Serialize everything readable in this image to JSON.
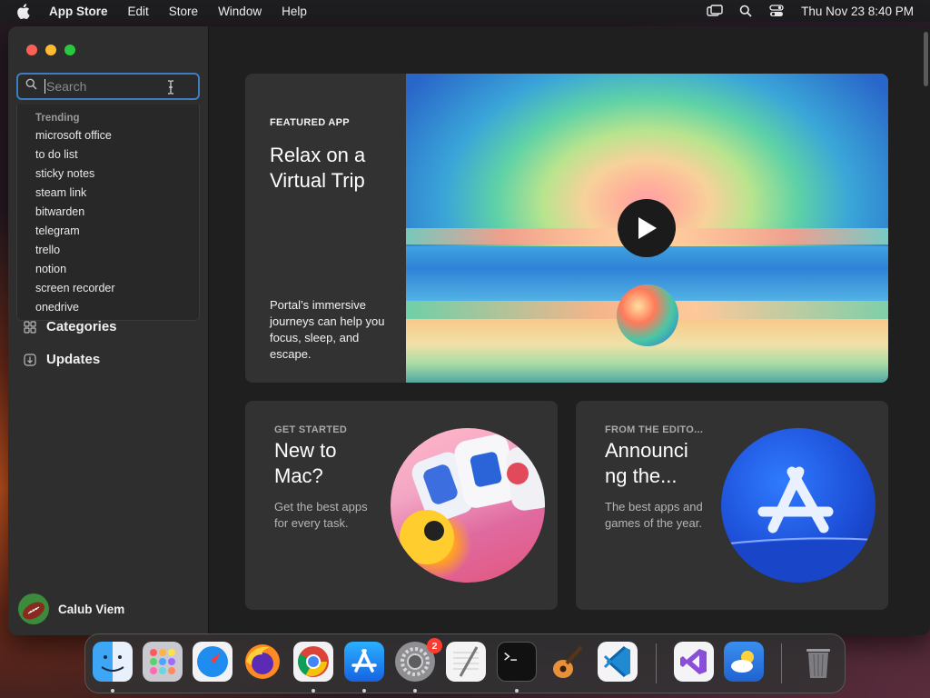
{
  "menubar": {
    "app_name": "App Store",
    "menus": [
      "Edit",
      "Store",
      "Window",
      "Help"
    ],
    "clock": "Thu Nov 23  8:40 PM"
  },
  "sidebar": {
    "search": {
      "placeholder": "Search",
      "value": ""
    },
    "trending_header": "Trending",
    "suggestions": [
      "microsoft office",
      "to do list",
      "sticky notes",
      "steam link",
      "bitwarden",
      "telegram",
      "trello",
      "notion",
      "screen recorder",
      "onedrive"
    ],
    "nav": [
      {
        "label": "Categories",
        "icon": "grid-icon"
      },
      {
        "label": "Updates",
        "icon": "download-icon"
      }
    ],
    "user_name": "Calub Viem"
  },
  "featured": {
    "eyebrow": "FEATURED APP",
    "title": "Relax on a Virtual Trip",
    "description": "Portal’s immersive journeys can help you focus, sleep, and escape."
  },
  "cards": [
    {
      "eyebrow": "GET STARTED",
      "title": "New to Mac?",
      "description": "Get the best apps for every task."
    },
    {
      "eyebrow": "FROM THE EDITO...",
      "title": "Announci ng the...",
      "description": "The best apps and games of the year."
    }
  ],
  "dock": {
    "apps": [
      "Finder",
      "Launchpad",
      "Safari",
      "Firefox",
      "Chrome",
      "App Store",
      "System Settings",
      "TextEdit",
      "Terminal",
      "GarageBand",
      "Visual Studio Code",
      "Visual Studio",
      "Weather",
      "Trash"
    ],
    "settings_badge": "2"
  },
  "colors": {
    "accent": "#3f7dc0",
    "window_bg": "#1f1f1f",
    "sidebar_bg": "#2e2e2f",
    "card_bg": "#323233"
  }
}
